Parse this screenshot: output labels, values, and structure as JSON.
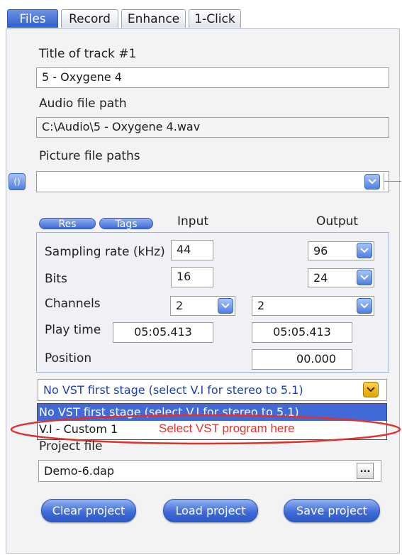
{
  "tabs": [
    {
      "label": "Files",
      "active": true
    },
    {
      "label": "Record",
      "active": false
    },
    {
      "label": "Enhance",
      "active": false
    },
    {
      "label": "1-Click",
      "active": false
    }
  ],
  "track": {
    "title_label": "Title of track #1",
    "title_value": "5 - Oxygene 4",
    "audio_label": "Audio file path",
    "audio_value": "C:\\Audio\\5 - Oxygene 4.wav",
    "picture_label": "Picture file paths",
    "picture_value": ""
  },
  "settings": {
    "subtabs": [
      "Res",
      "Tags"
    ],
    "input_header": "Input",
    "output_header": "Output",
    "rows": {
      "sampling": {
        "label": "Sampling rate (kHz)",
        "input": "44",
        "output": "96"
      },
      "bits": {
        "label": "Bits",
        "input": "16",
        "output": "24"
      },
      "channels": {
        "label": "Channels",
        "input": "2",
        "output": "2"
      },
      "play_time": {
        "label": "Play time",
        "input": "05:05.413",
        "output": "05:05.413"
      },
      "position": {
        "label": "Position",
        "output": "00.000"
      }
    }
  },
  "vst": {
    "selected": "No VST first stage (select V.I for stereo to 5.1)",
    "options": [
      "No VST first stage (select V.I for stereo to 5.1)",
      "V.I - Custom 1"
    ],
    "annotation": "Select VST program here",
    "annotation_color": "#e0322a"
  },
  "project": {
    "label": "Project file",
    "value": "Demo-6.dap",
    "browse_label": "...",
    "buttons": {
      "clear": "Clear project",
      "load": "Load project",
      "save": "Save project"
    }
  },
  "colors": {
    "accent": "#3d68d5",
    "selection": "#4169d7",
    "highlight_button": "#e0a400"
  }
}
